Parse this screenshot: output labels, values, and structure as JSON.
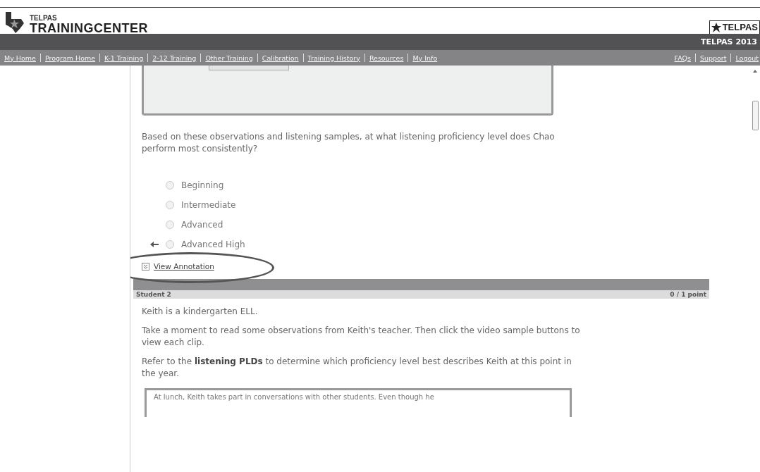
{
  "header": {
    "logo_small": "TELPAS",
    "logo_large": "TRAININGCENTER",
    "badge": "TELPAS",
    "edition": "TELPAS 2013"
  },
  "nav": {
    "left": [
      {
        "label": "My Home"
      },
      {
        "label": "Program Home"
      },
      {
        "label": "K-1 Training"
      },
      {
        "label": "2-12 Training"
      },
      {
        "label": "Other Training"
      },
      {
        "label": "Calibration"
      },
      {
        "label": "Training History"
      },
      {
        "label": "Resources"
      },
      {
        "label": "My Info"
      }
    ],
    "right": [
      {
        "label": "FAQs"
      },
      {
        "label": "Support"
      },
      {
        "label": "Logout"
      }
    ]
  },
  "question": {
    "text": "Based on these observations and listening samples, at what listening proficiency level does Chao perform most consistently?",
    "options": [
      {
        "label": "Beginning",
        "selected": false,
        "correct": false
      },
      {
        "label": "Intermediate",
        "selected": false,
        "correct": false
      },
      {
        "label": "Advanced",
        "selected": false,
        "correct": false
      },
      {
        "label": "Advanced High",
        "selected": false,
        "correct": true
      }
    ],
    "annotation_link": "View Annotation",
    "circled": true
  },
  "student": {
    "title": "Student 2",
    "score": "0 / 1 point",
    "paragraphs": [
      "Keith is a kindergarten ELL.",
      "Take a moment to read some observations from Keith's teacher. Then click the video sample buttons to view each clip.",
      "Refer to the **listening PLDs** to determine which proficiency level best describes Keith at this point in the year."
    ],
    "observation": "At lunch, Keith takes part in conversations with other students. Even though he"
  }
}
